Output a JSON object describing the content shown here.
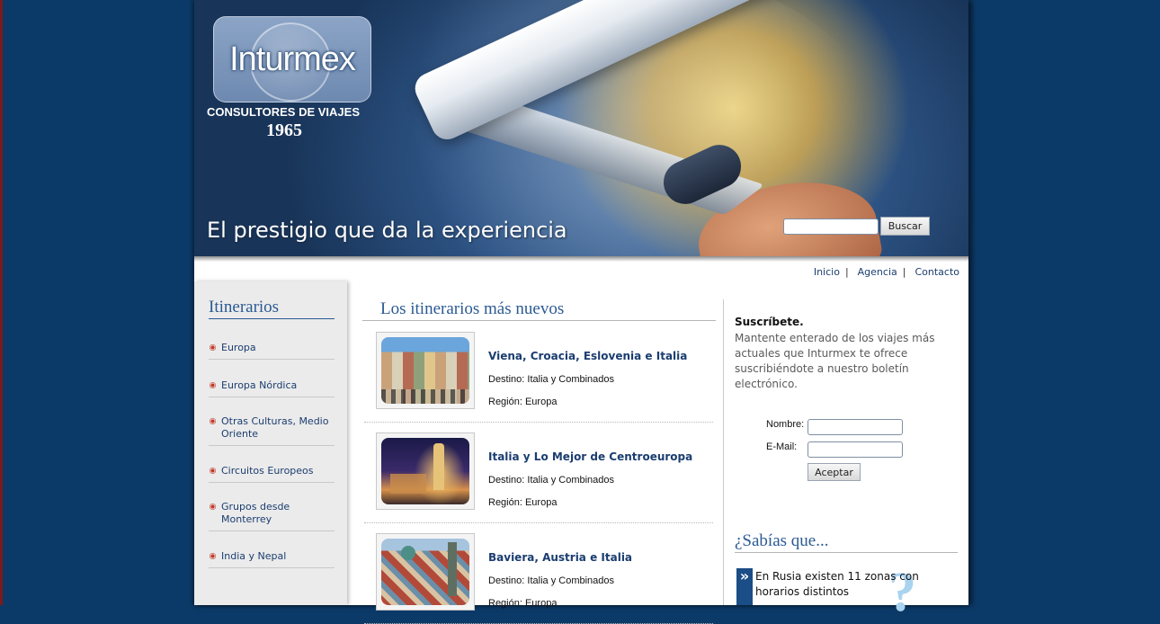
{
  "header": {
    "logo_name": "Inturmex",
    "logo_subtitle": "CONSULTORES DE VIAJES",
    "logo_year": "1965",
    "slogan": "El prestigio que da la experiencia",
    "search": {
      "value": "",
      "placeholder": "",
      "button_label": "Buscar"
    }
  },
  "top_nav": {
    "items": [
      {
        "label": "Inicio"
      },
      {
        "label": "Agencia"
      },
      {
        "label": "Contacto"
      }
    ],
    "separator": "|"
  },
  "sidebar": {
    "title": "Itinerarios",
    "items": [
      {
        "label": "Europa"
      },
      {
        "label": "Europa Nórdica"
      },
      {
        "label": "Otras Culturas, Medio Oriente"
      },
      {
        "label": "Circuitos Europeos"
      },
      {
        "label": "Grupos desde Monterrey"
      },
      {
        "label": "India y Nepal"
      }
    ]
  },
  "main": {
    "title": "Los itinerarios más nuevos",
    "trips": [
      {
        "title": "Viena, Croacia, Eslovenia e Italia",
        "destino": "Destino: Italia y Combinados",
        "region": "Región: Europa",
        "image_icon": "colorful-townhouses-photo"
      },
      {
        "title": "Italia y Lo Mejor de Centroeuropa",
        "destino": "Destino: Italia y Combinados",
        "region": "Región: Europa",
        "image_icon": "night-city-photo"
      },
      {
        "title": "Baviera, Austria e Italia",
        "destino": "Destino: Italia y Combinados",
        "region": "Región: Europa",
        "image_icon": "old-town-rooftops-photo"
      }
    ]
  },
  "subscribe": {
    "heading": "Suscríbete.",
    "text": "Mantente enterado de los viajes más actuales que Inturmex te ofrece suscribiéndote a nuestro boletín electrónico.",
    "name_label": "Nombre:",
    "email_label": "E-Mail:",
    "name_value": "",
    "email_value": "",
    "button_label": "Aceptar"
  },
  "did_you_know": {
    "title": "¿Sabías que...",
    "marker": "»",
    "background_mark": "?",
    "fact": "En Rusia existen 11 zonas con horarios distintos"
  },
  "colors": {
    "background": "#0c3a68",
    "link": "#1b3d70",
    "heading": "#2b5a93",
    "sidebar_bg": "#ebebeb"
  }
}
